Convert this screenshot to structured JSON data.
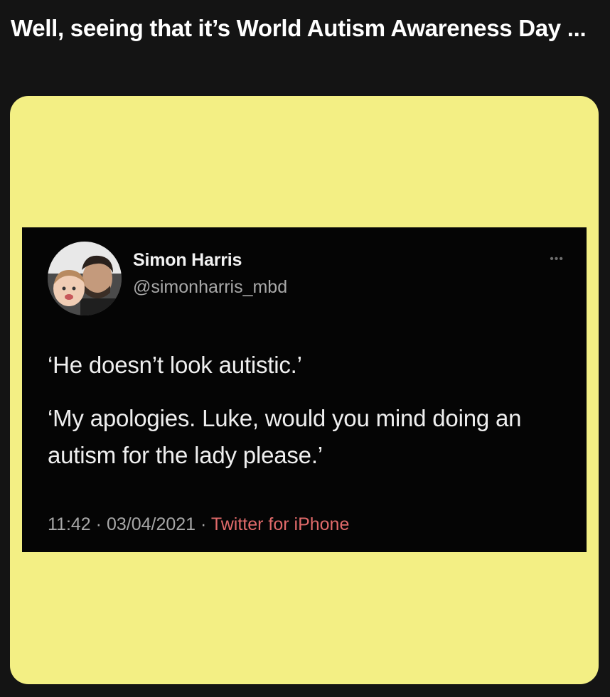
{
  "post": {
    "caption": "Well, seeing that it’s World Autism Awareness Day ..."
  },
  "card": {
    "background": "#f3ef84"
  },
  "tweet": {
    "author_name": "Simon Harris",
    "author_handle": "@simonharris_mbd",
    "more_icon": "more-horizontal-icon",
    "lines": [
      "‘He doesn’t look autistic.’",
      "‘My apologies. Luke, would you mind doing an autism for the lady please.’"
    ],
    "time": "11:42",
    "date": "03/04/2021",
    "separator": " · ",
    "source": "Twitter for iPhone",
    "source_color": "#e06a6a"
  }
}
